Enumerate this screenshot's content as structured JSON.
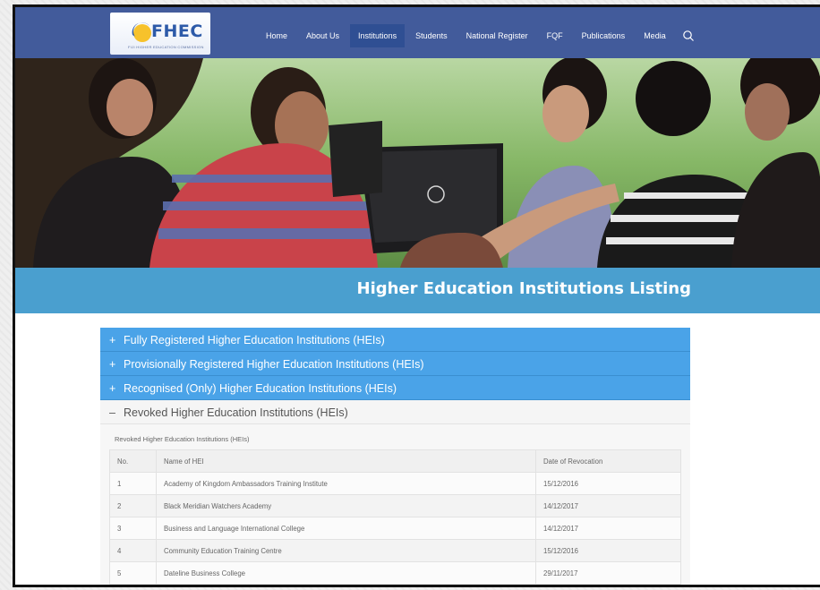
{
  "logo": {
    "text": "FHEC",
    "subtitle": "FIJI HIGHER EDUCATION COMMISSION"
  },
  "nav": {
    "items": [
      {
        "label": "Home",
        "active": false
      },
      {
        "label": "About Us",
        "active": false
      },
      {
        "label": "Institutions",
        "active": true
      },
      {
        "label": "Students",
        "active": false
      },
      {
        "label": "National Register",
        "active": false
      },
      {
        "label": "FQF",
        "active": false
      },
      {
        "label": "Publications",
        "active": false
      },
      {
        "label": "Media",
        "active": false
      }
    ],
    "search_icon": "search-icon"
  },
  "page_title": "Higher Education Institutions Listing",
  "accordion": {
    "sections": [
      {
        "sign": "+",
        "label": "Fully Registered Higher Education Institutions (HEIs)",
        "open": false
      },
      {
        "sign": "+",
        "label": "Provisionally Registered Higher Education Institutions (HEIs)",
        "open": false
      },
      {
        "sign": "+",
        "label": "Recognised (Only) Higher Education Institutions (HEIs)",
        "open": false
      },
      {
        "sign": "–",
        "label": "Revoked Higher Education Institutions (HEIs)",
        "open": true
      }
    ],
    "open_caption": "Revoked Higher Education Institutions (HEIs)",
    "table": {
      "headers": [
        "No.",
        "Name of HEI",
        "Date of Revocation"
      ],
      "rows": [
        [
          "1",
          "Academy of Kingdom Ambassadors Training Institute",
          "15/12/2016"
        ],
        [
          "2",
          "Black Meridian Watchers Academy",
          "14/12/2017"
        ],
        [
          "3",
          "Business and Language International College",
          "14/12/2017"
        ],
        [
          "4",
          "Community Education Training Centre",
          "15/12/2016"
        ],
        [
          "5",
          "Dateline Business College",
          "29/11/2017"
        ]
      ]
    }
  },
  "colors": {
    "nav_bg": "#425b9b",
    "nav_active": "#2f4f93",
    "title_bar": "#4a9fcf",
    "accordion_head": "#4aa3e8"
  }
}
